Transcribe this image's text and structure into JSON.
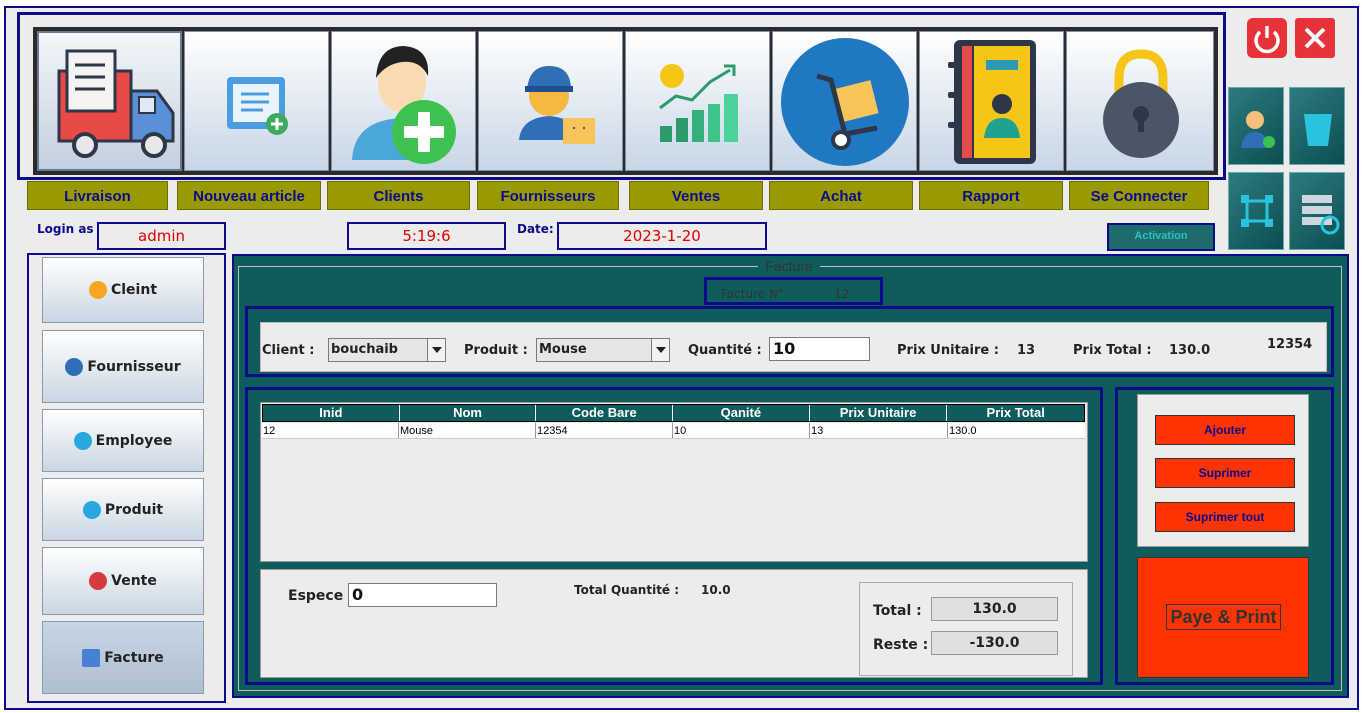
{
  "window": {
    "title_partial": ""
  },
  "toolbar": {
    "labels": [
      "Livraison",
      "Nouveau article",
      "Clients",
      "Fournisseurs",
      "Ventes",
      "Achat",
      "Rapport",
      "Se Connecter"
    ],
    "icons": [
      "delivery-truck-icon",
      "new-article-icon",
      "add-client-icon",
      "supplier-icon",
      "sales-chart-icon",
      "purchase-cart-icon",
      "report-notebook-icon",
      "padlock-icon"
    ]
  },
  "window_controls": {
    "power_icon": "power-icon",
    "close_icon": "close-icon"
  },
  "side_tools": {
    "user_check_icon": "user-check-icon",
    "trash_icon": "trash-icon",
    "network_icon": "network-icon",
    "db_restore_icon": "database-restore-icon"
  },
  "status": {
    "login_label": "Login as :",
    "login_value": "admin",
    "time_value": "5:19:6",
    "date_label": "Date:",
    "date_value": "2023-1-20",
    "activation_label": "Activation"
  },
  "sidebar": {
    "items": [
      {
        "label": "Cleint",
        "icon": "client-icon"
      },
      {
        "label": "Fournisseur",
        "icon": "supplier-icon"
      },
      {
        "label": "Employee",
        "icon": "employee-icon"
      },
      {
        "label": "Produit",
        "icon": "product-icon"
      },
      {
        "label": "Vente",
        "icon": "basket-icon"
      },
      {
        "label": "Facture",
        "icon": "invoice-icon"
      }
    ]
  },
  "facture": {
    "title": "Facture",
    "number_label": "Facture N° :",
    "number_value": "12",
    "client_label": "Client :",
    "client_value": "bouchaib",
    "produit_label": "Produit :",
    "produit_value": "Mouse",
    "quantite_label": "Quantité :",
    "quantite_value": "10",
    "prix_unitaire_label": "Prix Unitaire :",
    "prix_unitaire_value": "13",
    "prix_total_label": "Prix Total :",
    "prix_total_value": "130.0",
    "code_value": "12354"
  },
  "table": {
    "columns": [
      "Inid",
      "Nom",
      "Code Bare",
      "Qanité",
      "Prix Unitaire",
      "Prix Total"
    ],
    "rows": [
      [
        "12",
        "Mouse",
        "12354",
        "10",
        "13",
        "130.0"
      ]
    ]
  },
  "payment": {
    "espece_label": "Espece",
    "espece_value": "0",
    "total_quantite_label": "Total Quantité :",
    "total_quantite_value": "10.0",
    "total_label": "Total :",
    "total_value": "130.0",
    "reste_label": "Reste :",
    "reste_value": "-130.0"
  },
  "actions": {
    "ajouter": "Ajouter",
    "suprimer": "Suprimer",
    "suprimer_tout": "Suprimer tout",
    "pay_print": "Paye & Print"
  },
  "colors": {
    "navy": "#0b0b8c",
    "teal": "#0e5c5c",
    "olive": "#999900",
    "action_red": "#ff3300",
    "value_red": "#e00000"
  }
}
